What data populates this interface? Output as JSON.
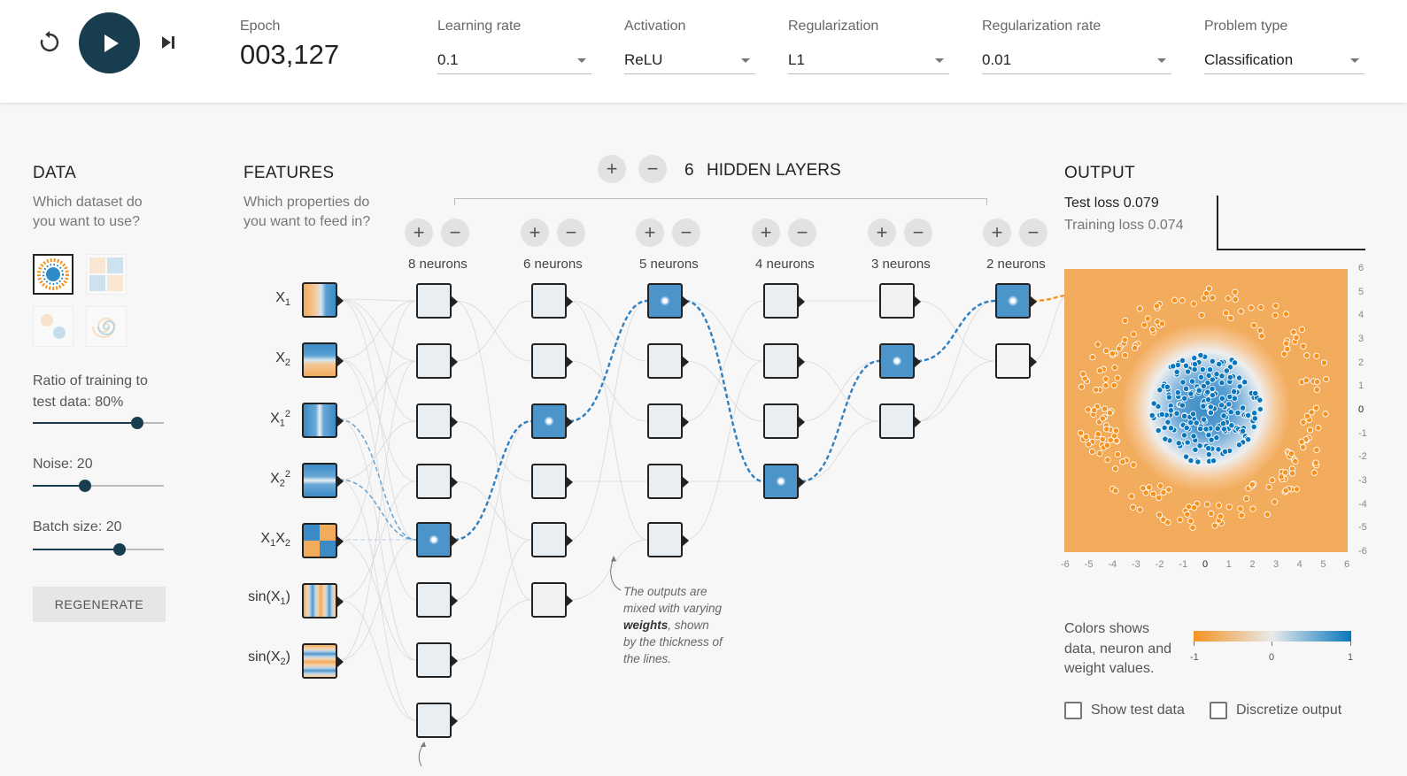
{
  "toolbar": {
    "epoch_label": "Epoch",
    "epoch_value": "003,127",
    "learning_rate": {
      "label": "Learning rate",
      "value": "0.1"
    },
    "activation": {
      "label": "Activation",
      "value": "ReLU"
    },
    "regularization": {
      "label": "Regularization",
      "value": "L1"
    },
    "regularization_rate": {
      "label": "Regularization rate",
      "value": "0.01"
    },
    "problem_type": {
      "label": "Problem type",
      "value": "Classification"
    }
  },
  "data_panel": {
    "title": "DATA",
    "subtitle_line1": "Which dataset do",
    "subtitle_line2": "you want to use?",
    "ratio_label_line1": "Ratio of training to",
    "ratio_label_line2": "test data:  80%",
    "ratio_value": 0.8,
    "noise_label": "Noise:  20",
    "noise_value": 0.4,
    "batch_label": "Batch size:  20",
    "batch_value": 0.66,
    "regenerate": "REGENERATE"
  },
  "features_panel": {
    "title": "FEATURES",
    "subtitle_line1": "Which properties do",
    "subtitle_line2": "you want to feed in?"
  },
  "network": {
    "hidden_layers_count": "6",
    "hidden_layers_label": "HIDDEN LAYERS",
    "plus": "+",
    "minus": "−",
    "layers": [
      "8 neurons",
      "6 neurons",
      "5 neurons",
      "4 neurons",
      "3 neurons",
      "2 neurons"
    ],
    "note_line1": "The outputs are",
    "note_line2": "mixed with varying",
    "note_bold": "weights",
    "note_line3_rest": ", shown",
    "note_line4": "by the thickness of",
    "note_line5": "the lines."
  },
  "output_panel": {
    "title": "OUTPUT",
    "test_loss": "Test loss 0.079",
    "training_loss": "Training loss 0.074",
    "x_ticks": [
      "-6",
      "-5",
      "-4",
      "-3",
      "-2",
      "-1",
      "0",
      "1",
      "2",
      "3",
      "4",
      "5",
      "6"
    ],
    "y_ticks": [
      "6",
      "5",
      "4",
      "3",
      "2",
      "1",
      "0",
      "-1",
      "-2",
      "-3",
      "-4",
      "-5",
      "-6"
    ],
    "legend_text_line1": "Colors shows",
    "legend_text_line2": "data, neuron and",
    "legend_text_line3": "weight values.",
    "legend_min": "-1",
    "legend_mid": "0",
    "legend_max": "1",
    "show_test_data": "Show test data",
    "discretize_output": "Discretize output"
  },
  "colors": {
    "accent": "#183d4e",
    "positive": "#0877bd",
    "negative": "#f59322"
  }
}
